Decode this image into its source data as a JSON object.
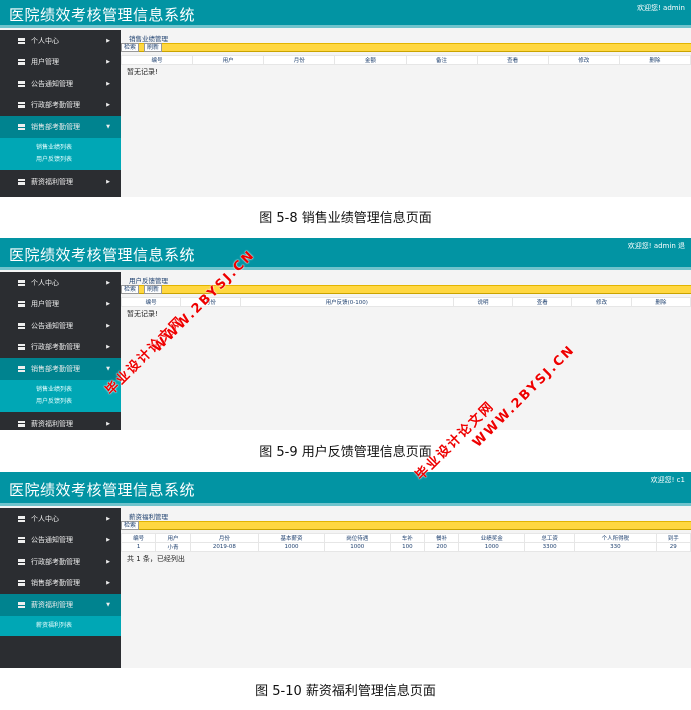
{
  "app_title": "医院绩效考核管理信息系统",
  "panels": [
    {
      "welcome": "欢迎您!   admin",
      "menu": [
        "个人中心",
        "用户管理",
        "公告通知管理",
        "行政部考勤管理",
        "销售部考勤管理",
        "薪资福利管理"
      ],
      "active": 4,
      "submenu": [
        "销售业绩列表",
        "用户反馈列表"
      ],
      "breadcrumb": "销售业绩管理",
      "buttons": [
        "检索",
        "刷新"
      ],
      "columns": [
        "编号",
        "用户",
        "月份",
        "金额",
        "备注",
        "查看",
        "修改",
        "删除"
      ],
      "rows": [],
      "message": "暂无记录!",
      "caption": "图 5-8 销售业绩管理信息页面"
    },
    {
      "welcome": "欢迎您!   admin  退",
      "menu": [
        "个人中心",
        "用户管理",
        "公告通知管理",
        "行政部考勤管理",
        "销售部考勤管理",
        "薪资福利管理"
      ],
      "active": 4,
      "submenu": [
        "销售业绩列表",
        "用户反馈列表"
      ],
      "breadcrumb": "用户反馈管理",
      "buttons": [
        "检索",
        "刷新"
      ],
      "columns": [
        "编号",
        "月份",
        "用户反馈(0-100)",
        "说明",
        "查看",
        "修改",
        "删除"
      ],
      "rows": [],
      "message": "暂无记录!",
      "caption": "图 5-9 用户反馈管理信息页面"
    },
    {
      "welcome": "欢迎您!   c1",
      "menu": [
        "个人中心",
        "公告通知管理",
        "行政部考勤管理",
        "销售部考勤管理",
        "薪资福利管理"
      ],
      "active": 4,
      "submenu": [
        "薪资福利列表"
      ],
      "breadcrumb": "薪资福利管理",
      "buttons": [
        "检索"
      ],
      "columns": [
        "编号",
        "用户",
        "月份",
        "基本薪资",
        "岗位待遇",
        "车补",
        "餐补",
        "业绩奖金",
        "总工资",
        "个人所得税",
        "到手"
      ],
      "rows": [
        [
          "1",
          "小青",
          "2019-08",
          "1000",
          "1000",
          "100",
          "200",
          "1000",
          "3300",
          "330",
          "29"
        ]
      ],
      "message": "共 1 条，已经列出",
      "caption": "图 5-10 薪资福利管理信息页面"
    }
  ],
  "watermark": {
    "line1": "毕业设计论文网",
    "line2": "WWW.2BYSJ.CN",
    "color": "#e00000"
  },
  "colors": {
    "header": "#0294a3",
    "sidebar": "#2b2d31",
    "toolbar": "#ffd740"
  }
}
